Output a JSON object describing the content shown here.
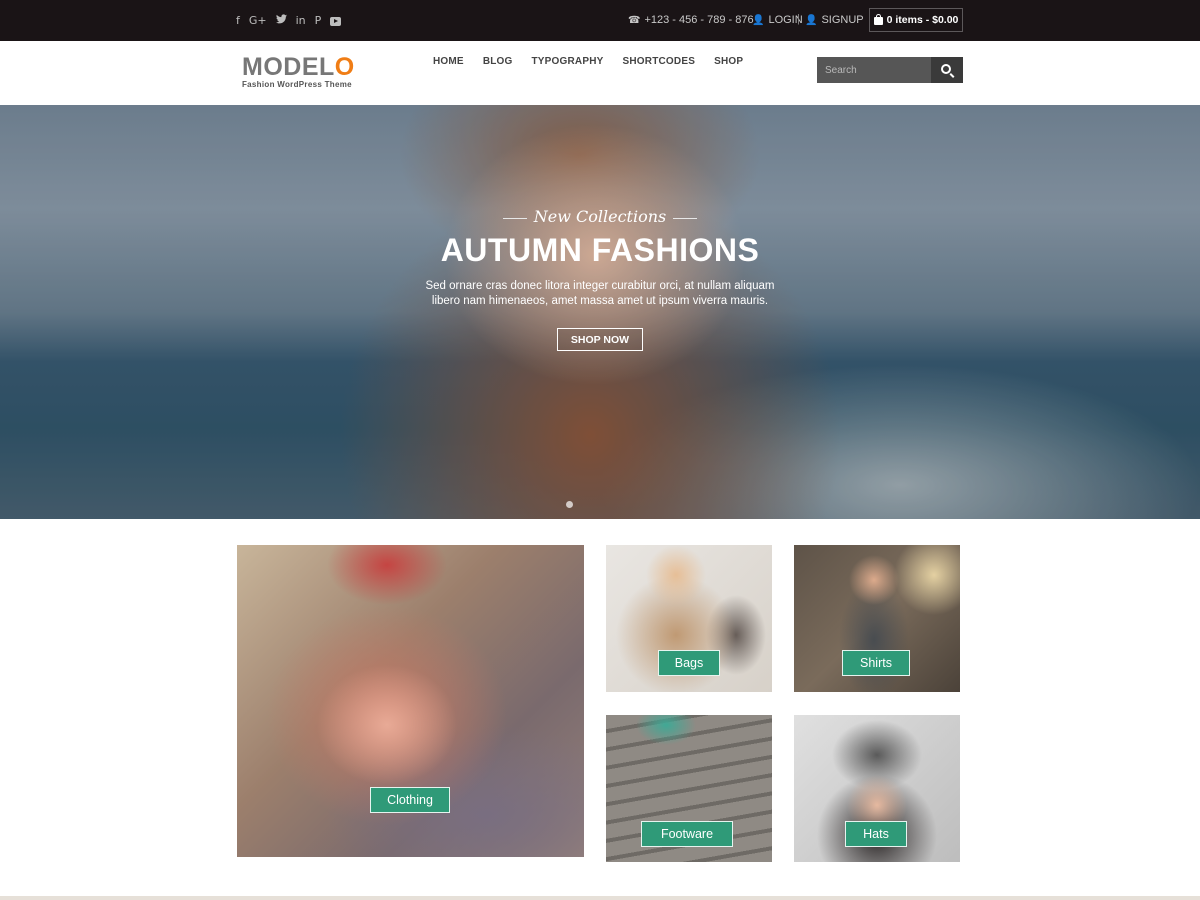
{
  "topbar": {
    "social_icons": [
      "facebook-icon",
      "google-plus-icon",
      "twitter-icon",
      "linkedin-icon",
      "pinterest-icon",
      "youtube-icon"
    ],
    "social_glyphs": {
      "facebook": "f",
      "google_plus": "G+",
      "twitter": "🐦",
      "linkedin": "in",
      "pinterest": "P"
    },
    "phone": "+123 - 456 - 789 - 876",
    "login": "LOGIN",
    "separator": "|",
    "signup": "SIGNUP",
    "cart": "0 items - $0.00",
    "background": "#1a1416"
  },
  "header": {
    "logo_main": "MODEL",
    "logo_accent": "O",
    "logo_tagline": "Fashion WordPress Theme",
    "nav": [
      "HOME",
      "BLOG",
      "TYPOGRAPHY",
      "SHORTCODES",
      "SHOP"
    ],
    "search_placeholder": "Search",
    "accent_color": "#f07d15"
  },
  "hero": {
    "kicker": "New Collections",
    "title": "AUTUMN FASHIONS",
    "description": "Sed ornare cras donec litora integer curabitur orci, at nullam aliquam libero nam himenaeos, amet massa amet ut ipsum viverra mauris.",
    "button": "SHOP NOW"
  },
  "categories": [
    {
      "label": "Clothing"
    },
    {
      "label": "Bags"
    },
    {
      "label": "Shirts"
    },
    {
      "label": "Footware"
    },
    {
      "label": "Hats"
    }
  ],
  "badge_color": "#2f9a78"
}
